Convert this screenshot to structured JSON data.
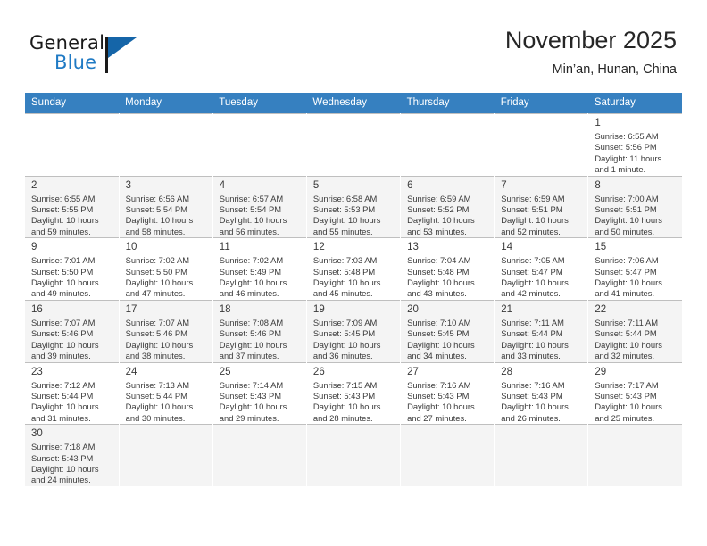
{
  "brand": {
    "name_top": "General",
    "name_bottom": "Blue",
    "accent_color": "#1f7ac4",
    "triangle_color": "#1565a8"
  },
  "header": {
    "title": "November 2025",
    "location": "Min’an, Hunan, China"
  },
  "calendar": {
    "header_bg": "#3680c0",
    "weekdays": [
      "Sunday",
      "Monday",
      "Tuesday",
      "Wednesday",
      "Thursday",
      "Friday",
      "Saturday"
    ],
    "weeks": [
      [
        {
          "day": "",
          "sunrise": "",
          "sunset": "",
          "daylight": "",
          "empty": true
        },
        {
          "day": "",
          "sunrise": "",
          "sunset": "",
          "daylight": "",
          "empty": true
        },
        {
          "day": "",
          "sunrise": "",
          "sunset": "",
          "daylight": "",
          "empty": true
        },
        {
          "day": "",
          "sunrise": "",
          "sunset": "",
          "daylight": "",
          "empty": true
        },
        {
          "day": "",
          "sunrise": "",
          "sunset": "",
          "daylight": "",
          "empty": true
        },
        {
          "day": "",
          "sunrise": "",
          "sunset": "",
          "daylight": "",
          "empty": true
        },
        {
          "day": "1",
          "sunrise": "Sunrise: 6:55 AM",
          "sunset": "Sunset: 5:56 PM",
          "daylight": "Daylight: 11 hours and 1 minute."
        }
      ],
      [
        {
          "day": "2",
          "sunrise": "Sunrise: 6:55 AM",
          "sunset": "Sunset: 5:55 PM",
          "daylight": "Daylight: 10 hours and 59 minutes."
        },
        {
          "day": "3",
          "sunrise": "Sunrise: 6:56 AM",
          "sunset": "Sunset: 5:54 PM",
          "daylight": "Daylight: 10 hours and 58 minutes."
        },
        {
          "day": "4",
          "sunrise": "Sunrise: 6:57 AM",
          "sunset": "Sunset: 5:54 PM",
          "daylight": "Daylight: 10 hours and 56 minutes."
        },
        {
          "day": "5",
          "sunrise": "Sunrise: 6:58 AM",
          "sunset": "Sunset: 5:53 PM",
          "daylight": "Daylight: 10 hours and 55 minutes."
        },
        {
          "day": "6",
          "sunrise": "Sunrise: 6:59 AM",
          "sunset": "Sunset: 5:52 PM",
          "daylight": "Daylight: 10 hours and 53 minutes."
        },
        {
          "day": "7",
          "sunrise": "Sunrise: 6:59 AM",
          "sunset": "Sunset: 5:51 PM",
          "daylight": "Daylight: 10 hours and 52 minutes."
        },
        {
          "day": "8",
          "sunrise": "Sunrise: 7:00 AM",
          "sunset": "Sunset: 5:51 PM",
          "daylight": "Daylight: 10 hours and 50 minutes."
        }
      ],
      [
        {
          "day": "9",
          "sunrise": "Sunrise: 7:01 AM",
          "sunset": "Sunset: 5:50 PM",
          "daylight": "Daylight: 10 hours and 49 minutes."
        },
        {
          "day": "10",
          "sunrise": "Sunrise: 7:02 AM",
          "sunset": "Sunset: 5:50 PM",
          "daylight": "Daylight: 10 hours and 47 minutes."
        },
        {
          "day": "11",
          "sunrise": "Sunrise: 7:02 AM",
          "sunset": "Sunset: 5:49 PM",
          "daylight": "Daylight: 10 hours and 46 minutes."
        },
        {
          "day": "12",
          "sunrise": "Sunrise: 7:03 AM",
          "sunset": "Sunset: 5:48 PM",
          "daylight": "Daylight: 10 hours and 45 minutes."
        },
        {
          "day": "13",
          "sunrise": "Sunrise: 7:04 AM",
          "sunset": "Sunset: 5:48 PM",
          "daylight": "Daylight: 10 hours and 43 minutes."
        },
        {
          "day": "14",
          "sunrise": "Sunrise: 7:05 AM",
          "sunset": "Sunset: 5:47 PM",
          "daylight": "Daylight: 10 hours and 42 minutes."
        },
        {
          "day": "15",
          "sunrise": "Sunrise: 7:06 AM",
          "sunset": "Sunset: 5:47 PM",
          "daylight": "Daylight: 10 hours and 41 minutes."
        }
      ],
      [
        {
          "day": "16",
          "sunrise": "Sunrise: 7:07 AM",
          "sunset": "Sunset: 5:46 PM",
          "daylight": "Daylight: 10 hours and 39 minutes."
        },
        {
          "day": "17",
          "sunrise": "Sunrise: 7:07 AM",
          "sunset": "Sunset: 5:46 PM",
          "daylight": "Daylight: 10 hours and 38 minutes."
        },
        {
          "day": "18",
          "sunrise": "Sunrise: 7:08 AM",
          "sunset": "Sunset: 5:46 PM",
          "daylight": "Daylight: 10 hours and 37 minutes."
        },
        {
          "day": "19",
          "sunrise": "Sunrise: 7:09 AM",
          "sunset": "Sunset: 5:45 PM",
          "daylight": "Daylight: 10 hours and 36 minutes."
        },
        {
          "day": "20",
          "sunrise": "Sunrise: 7:10 AM",
          "sunset": "Sunset: 5:45 PM",
          "daylight": "Daylight: 10 hours and 34 minutes."
        },
        {
          "day": "21",
          "sunrise": "Sunrise: 7:11 AM",
          "sunset": "Sunset: 5:44 PM",
          "daylight": "Daylight: 10 hours and 33 minutes."
        },
        {
          "day": "22",
          "sunrise": "Sunrise: 7:11 AM",
          "sunset": "Sunset: 5:44 PM",
          "daylight": "Daylight: 10 hours and 32 minutes."
        }
      ],
      [
        {
          "day": "23",
          "sunrise": "Sunrise: 7:12 AM",
          "sunset": "Sunset: 5:44 PM",
          "daylight": "Daylight: 10 hours and 31 minutes."
        },
        {
          "day": "24",
          "sunrise": "Sunrise: 7:13 AM",
          "sunset": "Sunset: 5:44 PM",
          "daylight": "Daylight: 10 hours and 30 minutes."
        },
        {
          "day": "25",
          "sunrise": "Sunrise: 7:14 AM",
          "sunset": "Sunset: 5:43 PM",
          "daylight": "Daylight: 10 hours and 29 minutes."
        },
        {
          "day": "26",
          "sunrise": "Sunrise: 7:15 AM",
          "sunset": "Sunset: 5:43 PM",
          "daylight": "Daylight: 10 hours and 28 minutes."
        },
        {
          "day": "27",
          "sunrise": "Sunrise: 7:16 AM",
          "sunset": "Sunset: 5:43 PM",
          "daylight": "Daylight: 10 hours and 27 minutes."
        },
        {
          "day": "28",
          "sunrise": "Sunrise: 7:16 AM",
          "sunset": "Sunset: 5:43 PM",
          "daylight": "Daylight: 10 hours and 26 minutes."
        },
        {
          "day": "29",
          "sunrise": "Sunrise: 7:17 AM",
          "sunset": "Sunset: 5:43 PM",
          "daylight": "Daylight: 10 hours and 25 minutes."
        }
      ],
      [
        {
          "day": "30",
          "sunrise": "Sunrise: 7:18 AM",
          "sunset": "Sunset: 5:43 PM",
          "daylight": "Daylight: 10 hours and 24 minutes."
        },
        {
          "day": "",
          "sunrise": "",
          "sunset": "",
          "daylight": "",
          "empty": true
        },
        {
          "day": "",
          "sunrise": "",
          "sunset": "",
          "daylight": "",
          "empty": true
        },
        {
          "day": "",
          "sunrise": "",
          "sunset": "",
          "daylight": "",
          "empty": true
        },
        {
          "day": "",
          "sunrise": "",
          "sunset": "",
          "daylight": "",
          "empty": true
        },
        {
          "day": "",
          "sunrise": "",
          "sunset": "",
          "daylight": "",
          "empty": true
        },
        {
          "day": "",
          "sunrise": "",
          "sunset": "",
          "daylight": "",
          "empty": true
        }
      ]
    ]
  }
}
